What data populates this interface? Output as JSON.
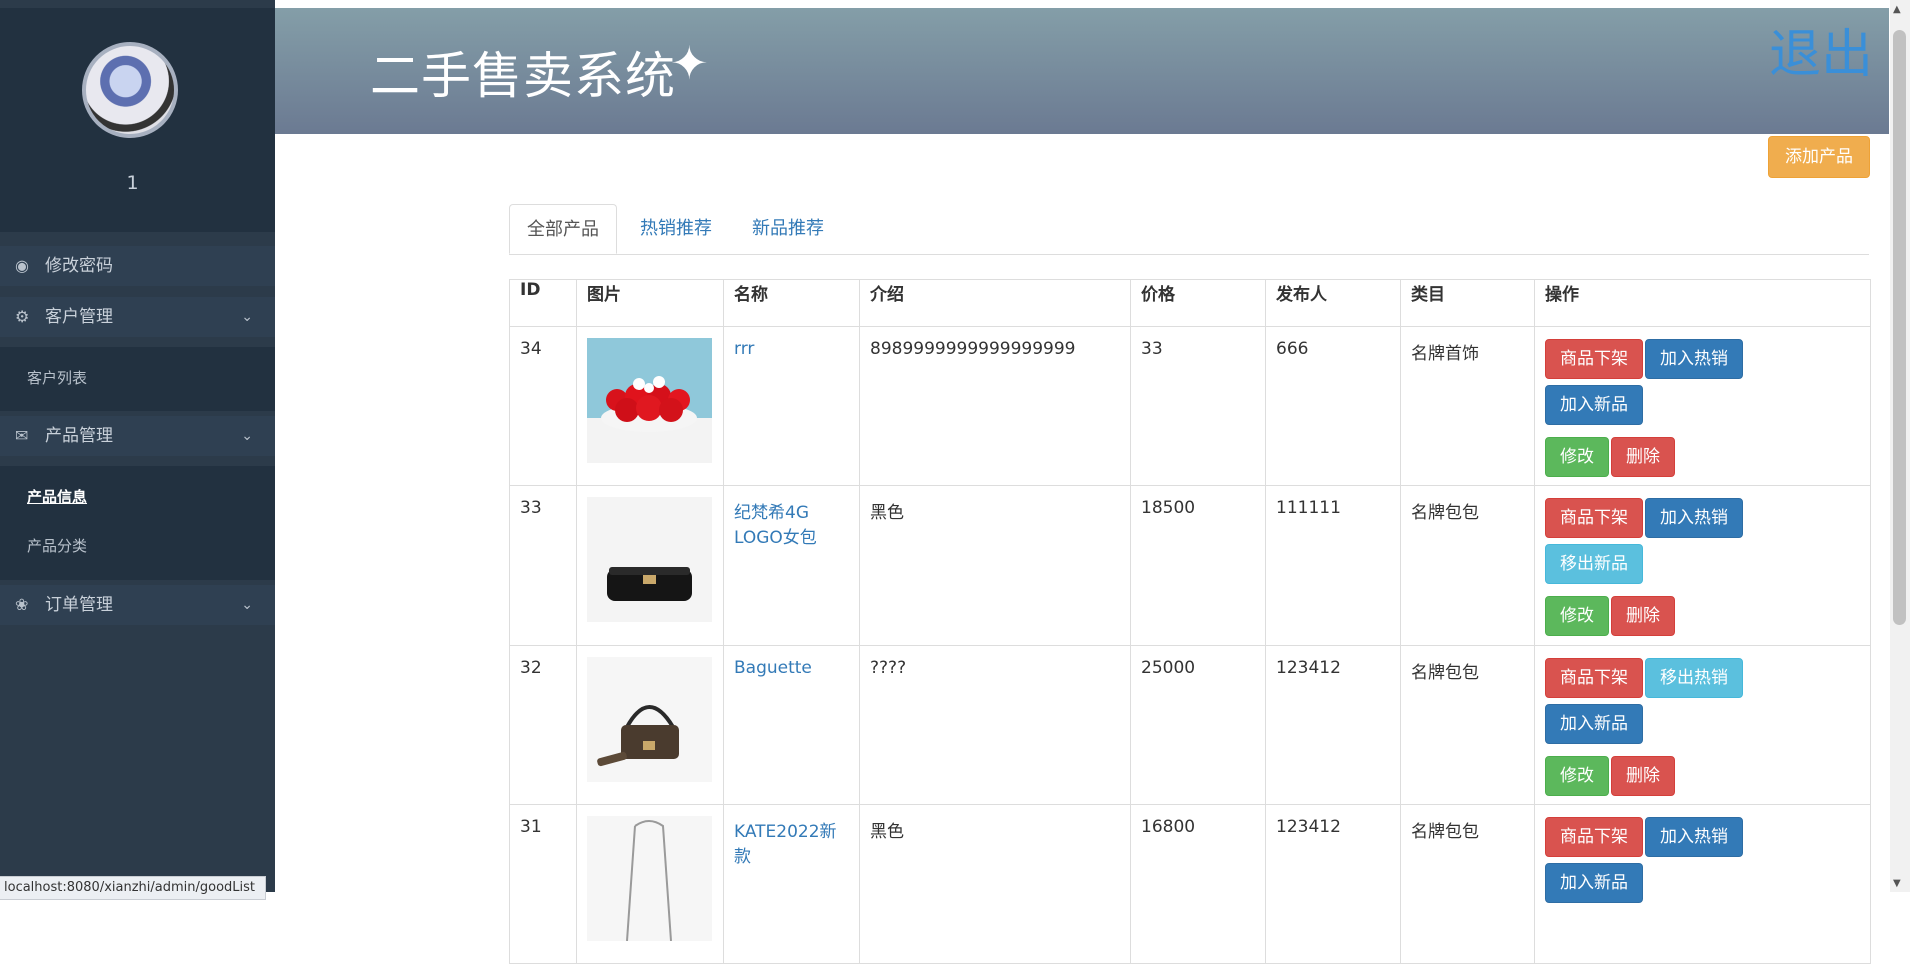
{
  "sidebar": {
    "username": "1",
    "menu": [
      {
        "label": "修改密码",
        "icon": "dashboard-icon"
      },
      {
        "label": "客户管理",
        "icon": "gears-icon"
      },
      {
        "label": "产品管理",
        "icon": "comments-icon"
      },
      {
        "label": "订单管理",
        "icon": "bug-icon"
      }
    ],
    "sub_customer": [
      "客户列表"
    ],
    "sub_product": [
      "产品信息",
      "产品分类"
    ]
  },
  "status_url": "localhost:8080/xianzhi/admin/goodList",
  "header": {
    "title": "二手售卖系统",
    "logout": "退出"
  },
  "toolbar": {
    "add_label": "添加产品"
  },
  "tabs": [
    "全部产品",
    "热销推荐",
    "新品推荐"
  ],
  "table": {
    "headers": [
      "ID",
      "图片",
      "名称",
      "介绍",
      "价格",
      "发布人",
      "类目",
      "操作"
    ],
    "rows": [
      {
        "id": "34",
        "name": "rrr",
        "intro": "8989999999999999999",
        "price": "33",
        "publisher": "666",
        "category": "名牌首饰",
        "image": "red-cake",
        "buttons": [
          {
            "label": "商品下架",
            "style": "danger"
          },
          {
            "label": "加入热销",
            "style": "primary"
          },
          {
            "label": "加入新品",
            "style": "primary"
          },
          {
            "label": "修改",
            "style": "success"
          },
          {
            "label": "删除",
            "style": "danger"
          }
        ]
      },
      {
        "id": "33",
        "name": "纪梵希4G LOGO女包",
        "intro": "黑色",
        "price": "18500",
        "publisher": "111111",
        "category": "名牌包包",
        "image": "black-bag",
        "buttons": [
          {
            "label": "商品下架",
            "style": "danger"
          },
          {
            "label": "加入热销",
            "style": "primary"
          },
          {
            "label": "移出新品",
            "style": "info"
          },
          {
            "label": "修改",
            "style": "success"
          },
          {
            "label": "删除",
            "style": "danger"
          }
        ]
      },
      {
        "id": "32",
        "name": "Baguette",
        "intro": "????",
        "price": "25000",
        "publisher": "123412",
        "category": "名牌包包",
        "image": "brown-bag",
        "buttons": [
          {
            "label": "商品下架",
            "style": "danger"
          },
          {
            "label": "移出热销",
            "style": "info"
          },
          {
            "label": "加入新品",
            "style": "primary"
          },
          {
            "label": "修改",
            "style": "success"
          },
          {
            "label": "删除",
            "style": "danger"
          }
        ]
      },
      {
        "id": "31",
        "name": "KATE2022新款",
        "intro": "黑色",
        "price": "16800",
        "publisher": "123412",
        "category": "名牌包包",
        "image": "chain-bag",
        "buttons": [
          {
            "label": "商品下架",
            "style": "danger"
          },
          {
            "label": "加入热销",
            "style": "primary"
          },
          {
            "label": "加入新品",
            "style": "primary"
          }
        ]
      }
    ]
  },
  "colors": {
    "sidebar": "#2c3b4a",
    "header_top": "#849ea8",
    "header_bottom": "#6b7a92",
    "link": "#337ab7",
    "logout": "#3a8fd8",
    "warning": "#f0ad4e"
  }
}
